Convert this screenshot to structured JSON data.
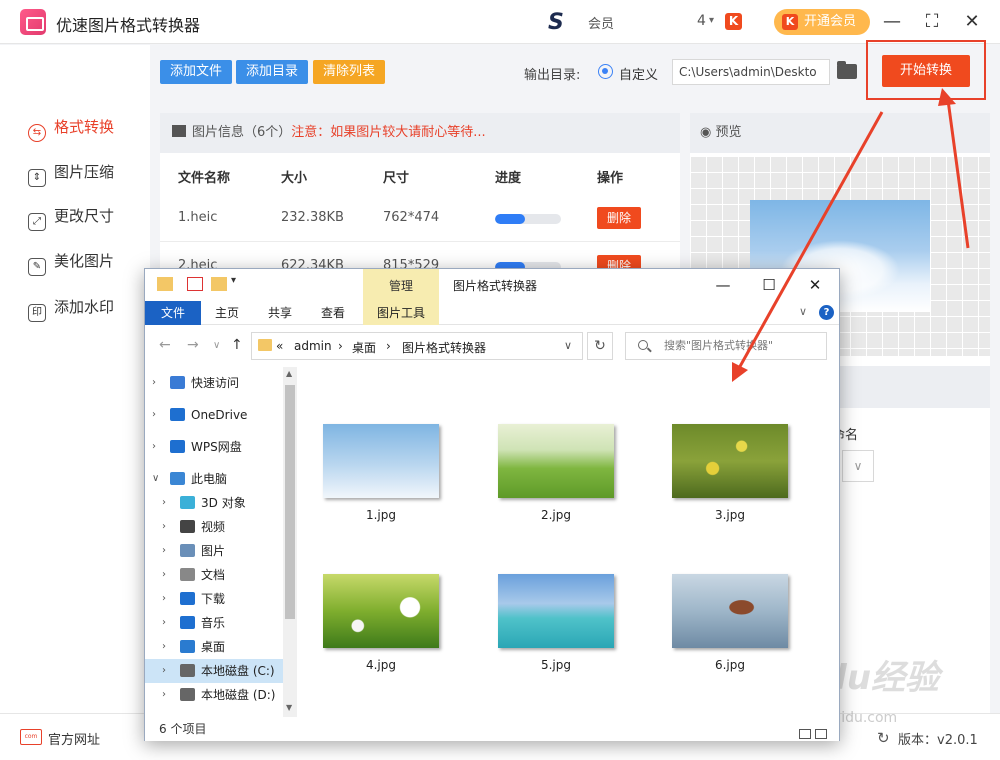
{
  "app": {
    "title": "优速图片格式转换器",
    "user_text": "会员 ",
    "user_count": "4",
    "user_caret": "▾",
    "k_badge": "K",
    "vip_label": "开通会员",
    "controls": {
      "minimize": "—",
      "maximize": "⛶",
      "close": "✕"
    }
  },
  "sidebar": {
    "items": [
      {
        "label": "格式转换",
        "icon": "swap-icon",
        "glyph": "⇆",
        "active": true
      },
      {
        "label": "图片压缩",
        "icon": "compress-icon",
        "glyph": "⇕",
        "active": false
      },
      {
        "label": "更改尺寸",
        "icon": "resize-icon",
        "glyph": "⤢",
        "active": false
      },
      {
        "label": "美化图片",
        "icon": "beautify-icon",
        "glyph": "✎",
        "active": false
      },
      {
        "label": "添加水印",
        "icon": "watermark-icon",
        "glyph": "印",
        "active": false
      }
    ]
  },
  "toolbar": {
    "add_file": "添加文件",
    "add_dir": "添加目录",
    "clear_list": "清除列表",
    "output_label": "输出目录:",
    "radio_label": "自定义",
    "path_value": "C:\\Users\\admin\\Deskto",
    "start_label": "开始转换"
  },
  "colors": {
    "accent": "#f04a1e",
    "blue": "#2f7df6",
    "clear_btn": "#f5a623",
    "file_btn": "#3b8fe8"
  },
  "list": {
    "info_label": "图片信息（6个）",
    "info_warning": "注意：如果图片较大请耐心等待...",
    "headers": [
      "文件名称",
      "大小",
      "尺寸",
      "进度",
      "操作"
    ],
    "rows": [
      {
        "name": "1.heic",
        "size": "232.38KB",
        "dims": "762*474",
        "progress": 0.45,
        "action": "删除"
      },
      {
        "name": "2.heic",
        "size": "622.34KB",
        "dims": "815*529",
        "progress": 0.45,
        "action": "删除"
      }
    ]
  },
  "preview": {
    "title": "预览",
    "rename_label": "命名",
    "rename_caret": "∨"
  },
  "footer": {
    "site_icon_text": "com",
    "site_label": "官方网址",
    "version_icon": "↻",
    "version": "版本：v2.0.1"
  },
  "explorer": {
    "manage_tab": "管理",
    "title": "图片格式转换器",
    "controls": {
      "minimize": "—",
      "maximize": "☐",
      "close": "✕"
    },
    "ribbon_tabs": [
      "文件",
      "主页",
      "共享",
      "查看",
      "图片工具"
    ],
    "nav": {
      "back": "←",
      "forward": "→",
      "up": "↑",
      "dropdown": "∨",
      "prefix": "«",
      "refresh": "↻"
    },
    "breadcrumb": [
      "admin",
      "桌面",
      "图片格式转换器"
    ],
    "search_placeholder": "搜索\"图片格式转换器\"",
    "tree": [
      {
        "label": "快速访问",
        "icon": "star-icon",
        "level": 0,
        "selected": false
      },
      {
        "label": "OneDrive",
        "icon": "cloud-icon",
        "level": 0,
        "selected": false
      },
      {
        "label": "WPS网盘",
        "icon": "cloud-icon",
        "level": 0,
        "selected": false
      },
      {
        "label": "此电脑",
        "icon": "computer-icon",
        "level": 0,
        "selected": false
      },
      {
        "label": "3D 对象",
        "icon": "cube-icon",
        "level": 1,
        "selected": false
      },
      {
        "label": "视频",
        "icon": "video-icon",
        "level": 1,
        "selected": false
      },
      {
        "label": "图片",
        "icon": "pictures-icon",
        "level": 1,
        "selected": false
      },
      {
        "label": "文档",
        "icon": "document-icon",
        "level": 1,
        "selected": false
      },
      {
        "label": "下载",
        "icon": "download-icon",
        "level": 1,
        "selected": false
      },
      {
        "label": "音乐",
        "icon": "music-icon",
        "level": 1,
        "selected": false
      },
      {
        "label": "桌面",
        "icon": "desktop-icon",
        "level": 1,
        "selected": false
      },
      {
        "label": "本地磁盘 (C:)",
        "icon": "drive-icon",
        "level": 1,
        "selected": true
      },
      {
        "label": "本地磁盘 (D:)",
        "icon": "drive-icon",
        "level": 1,
        "selected": false
      }
    ],
    "files": [
      {
        "name": "1.jpg",
        "scene": "sky"
      },
      {
        "name": "2.jpg",
        "scene": "meadow"
      },
      {
        "name": "3.jpg",
        "scene": "flowers"
      },
      {
        "name": "4.jpg",
        "scene": "daisy"
      },
      {
        "name": "5.jpg",
        "scene": "pier"
      },
      {
        "name": "6.jpg",
        "scene": "lake"
      }
    ],
    "status": "6 个项目"
  },
  "watermark": {
    "brand": "Baidu经验",
    "url": "jingyan.baidu.com"
  }
}
